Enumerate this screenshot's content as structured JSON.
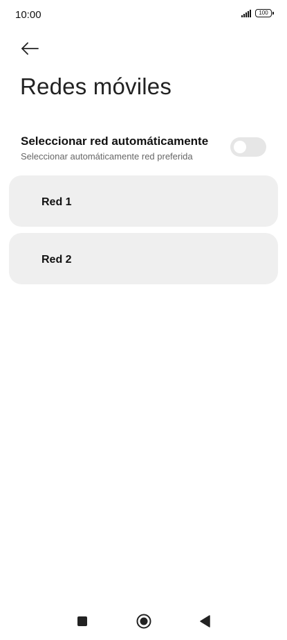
{
  "status_bar": {
    "time": "10:00",
    "battery": "100",
    "signal_icon": "signal-bars-icon",
    "battery_icon": "battery-icon"
  },
  "header": {
    "back_icon": "arrow-left-icon",
    "title": "Redes móviles"
  },
  "auto_select": {
    "title": "Seleccionar red automáticamente",
    "subtitle": "Seleccionar automáticamente red preferida",
    "enabled": false
  },
  "networks": [
    {
      "label": "Red 1"
    },
    {
      "label": "Red 2"
    }
  ],
  "nav_bar": {
    "recent_icon": "square-icon",
    "home_icon": "circle-icon",
    "back_icon": "triangle-back-icon"
  },
  "colors": {
    "card_background": "#efefef",
    "toggle_off": "#e6e6e6",
    "subtitle_text": "#666666",
    "nav_icons": "#111111"
  }
}
